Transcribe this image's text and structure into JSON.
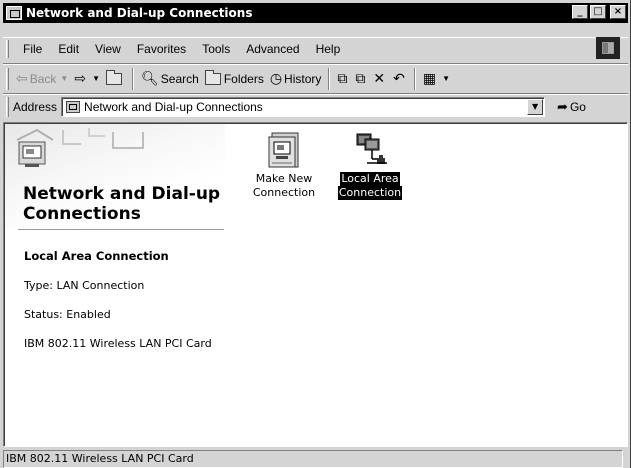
{
  "window": {
    "title": "Network and Dial-up Connections",
    "buttons": [
      "_",
      "□",
      "×"
    ]
  },
  "menu": [
    "File",
    "Edit",
    "View",
    "Favorites",
    "Tools",
    "Advanced",
    "Help"
  ],
  "toolbar": {
    "back": "Back",
    "search": "Search",
    "folders": "Folders",
    "history": "History"
  },
  "address": {
    "label": "Address",
    "value": "Network and Dial-up Connections",
    "go": "Go"
  },
  "panel": {
    "title": "Network and Dial-up Connections",
    "selected_name": "Local Area Connection",
    "type": "Type: LAN Connection",
    "status": "Status: Enabled",
    "device": "IBM 802.11 Wireless LAN PCI Card"
  },
  "items": [
    {
      "label_line1": "Make New",
      "label_line2": "Connection",
      "icon": "make-new-connection-icon"
    },
    {
      "label_line1": "Local Area",
      "label_line2": "Connection",
      "icon": "lan-connection-icon",
      "selected": true
    }
  ],
  "statusbar": {
    "text": "IBM 802.11 Wireless LAN PCI Card"
  }
}
